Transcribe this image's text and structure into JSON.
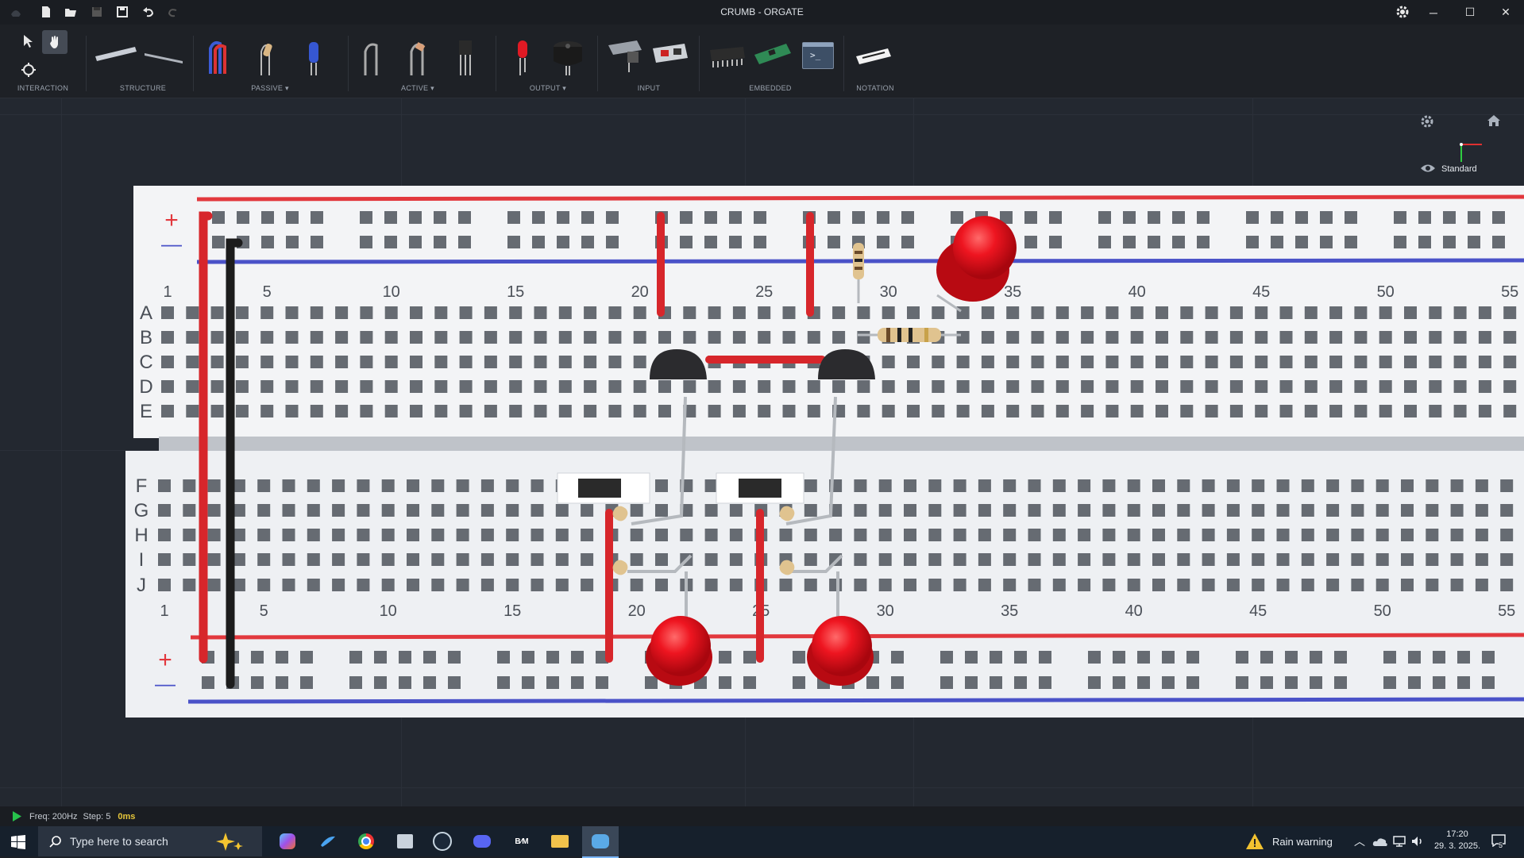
{
  "window": {
    "title": "CRUMB - ORGATE"
  },
  "toolbar": {
    "groups": [
      {
        "label": "INTERACTION"
      },
      {
        "label": "STRUCTURE"
      },
      {
        "label": "PASSIVE ▾"
      },
      {
        "label": "ACTIVE ▾"
      },
      {
        "label": "OUTPUT ▾"
      },
      {
        "label": "INPUT"
      },
      {
        "label": "EMBEDDED"
      },
      {
        "label": "NOTATION"
      }
    ]
  },
  "view": {
    "mode_label": "Standard"
  },
  "breadboard": {
    "rows_top": [
      "A",
      "B",
      "C",
      "D",
      "E"
    ],
    "rows_bottom": [
      "F",
      "G",
      "H",
      "I",
      "J"
    ],
    "col_numbers": [
      "1",
      "5",
      "10",
      "15",
      "20",
      "25",
      "30",
      "35",
      "40",
      "45",
      "50",
      "55"
    ],
    "plus": "+",
    "minus": "—"
  },
  "status": {
    "freq": "Freq: 200Hz",
    "step": "Step: 5",
    "time": "0ms"
  },
  "taskbar": {
    "search_placeholder": "Type here to search",
    "weather": "Rain warning",
    "time": "17:20",
    "date": "29. 3. 2025.",
    "notif_count": "5"
  },
  "colors": {
    "wire_red": "#d7262b",
    "wire_black": "#1c1c1c",
    "rail_red": "#e2383d",
    "rail_blue": "#4a52c8",
    "led_red": "#e80f1c"
  }
}
